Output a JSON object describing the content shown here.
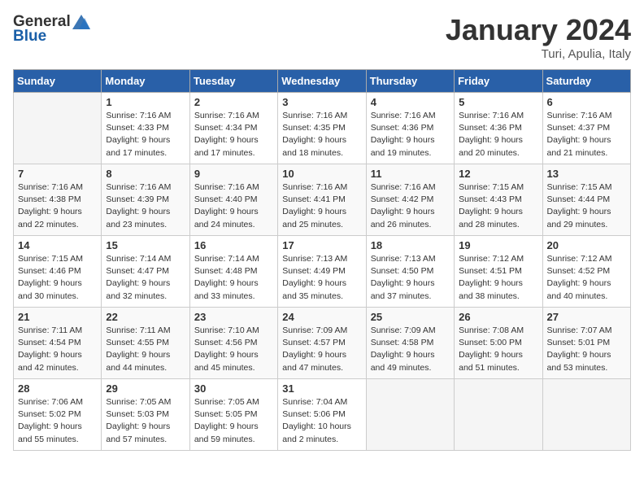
{
  "logo": {
    "general": "General",
    "blue": "Blue"
  },
  "title": {
    "month": "January 2024",
    "location": "Turi, Apulia, Italy"
  },
  "days_header": [
    "Sunday",
    "Monday",
    "Tuesday",
    "Wednesday",
    "Thursday",
    "Friday",
    "Saturday"
  ],
  "weeks": [
    [
      {
        "num": "",
        "info": ""
      },
      {
        "num": "1",
        "info": "Sunrise: 7:16 AM\nSunset: 4:33 PM\nDaylight: 9 hours\nand 17 minutes."
      },
      {
        "num": "2",
        "info": "Sunrise: 7:16 AM\nSunset: 4:34 PM\nDaylight: 9 hours\nand 17 minutes."
      },
      {
        "num": "3",
        "info": "Sunrise: 7:16 AM\nSunset: 4:35 PM\nDaylight: 9 hours\nand 18 minutes."
      },
      {
        "num": "4",
        "info": "Sunrise: 7:16 AM\nSunset: 4:36 PM\nDaylight: 9 hours\nand 19 minutes."
      },
      {
        "num": "5",
        "info": "Sunrise: 7:16 AM\nSunset: 4:36 PM\nDaylight: 9 hours\nand 20 minutes."
      },
      {
        "num": "6",
        "info": "Sunrise: 7:16 AM\nSunset: 4:37 PM\nDaylight: 9 hours\nand 21 minutes."
      }
    ],
    [
      {
        "num": "7",
        "info": "Sunrise: 7:16 AM\nSunset: 4:38 PM\nDaylight: 9 hours\nand 22 minutes."
      },
      {
        "num": "8",
        "info": "Sunrise: 7:16 AM\nSunset: 4:39 PM\nDaylight: 9 hours\nand 23 minutes."
      },
      {
        "num": "9",
        "info": "Sunrise: 7:16 AM\nSunset: 4:40 PM\nDaylight: 9 hours\nand 24 minutes."
      },
      {
        "num": "10",
        "info": "Sunrise: 7:16 AM\nSunset: 4:41 PM\nDaylight: 9 hours\nand 25 minutes."
      },
      {
        "num": "11",
        "info": "Sunrise: 7:16 AM\nSunset: 4:42 PM\nDaylight: 9 hours\nand 26 minutes."
      },
      {
        "num": "12",
        "info": "Sunrise: 7:15 AM\nSunset: 4:43 PM\nDaylight: 9 hours\nand 28 minutes."
      },
      {
        "num": "13",
        "info": "Sunrise: 7:15 AM\nSunset: 4:44 PM\nDaylight: 9 hours\nand 29 minutes."
      }
    ],
    [
      {
        "num": "14",
        "info": "Sunrise: 7:15 AM\nSunset: 4:46 PM\nDaylight: 9 hours\nand 30 minutes."
      },
      {
        "num": "15",
        "info": "Sunrise: 7:14 AM\nSunset: 4:47 PM\nDaylight: 9 hours\nand 32 minutes."
      },
      {
        "num": "16",
        "info": "Sunrise: 7:14 AM\nSunset: 4:48 PM\nDaylight: 9 hours\nand 33 minutes."
      },
      {
        "num": "17",
        "info": "Sunrise: 7:13 AM\nSunset: 4:49 PM\nDaylight: 9 hours\nand 35 minutes."
      },
      {
        "num": "18",
        "info": "Sunrise: 7:13 AM\nSunset: 4:50 PM\nDaylight: 9 hours\nand 37 minutes."
      },
      {
        "num": "19",
        "info": "Sunrise: 7:12 AM\nSunset: 4:51 PM\nDaylight: 9 hours\nand 38 minutes."
      },
      {
        "num": "20",
        "info": "Sunrise: 7:12 AM\nSunset: 4:52 PM\nDaylight: 9 hours\nand 40 minutes."
      }
    ],
    [
      {
        "num": "21",
        "info": "Sunrise: 7:11 AM\nSunset: 4:54 PM\nDaylight: 9 hours\nand 42 minutes."
      },
      {
        "num": "22",
        "info": "Sunrise: 7:11 AM\nSunset: 4:55 PM\nDaylight: 9 hours\nand 44 minutes."
      },
      {
        "num": "23",
        "info": "Sunrise: 7:10 AM\nSunset: 4:56 PM\nDaylight: 9 hours\nand 45 minutes."
      },
      {
        "num": "24",
        "info": "Sunrise: 7:09 AM\nSunset: 4:57 PM\nDaylight: 9 hours\nand 47 minutes."
      },
      {
        "num": "25",
        "info": "Sunrise: 7:09 AM\nSunset: 4:58 PM\nDaylight: 9 hours\nand 49 minutes."
      },
      {
        "num": "26",
        "info": "Sunrise: 7:08 AM\nSunset: 5:00 PM\nDaylight: 9 hours\nand 51 minutes."
      },
      {
        "num": "27",
        "info": "Sunrise: 7:07 AM\nSunset: 5:01 PM\nDaylight: 9 hours\nand 53 minutes."
      }
    ],
    [
      {
        "num": "28",
        "info": "Sunrise: 7:06 AM\nSunset: 5:02 PM\nDaylight: 9 hours\nand 55 minutes."
      },
      {
        "num": "29",
        "info": "Sunrise: 7:05 AM\nSunset: 5:03 PM\nDaylight: 9 hours\nand 57 minutes."
      },
      {
        "num": "30",
        "info": "Sunrise: 7:05 AM\nSunset: 5:05 PM\nDaylight: 9 hours\nand 59 minutes."
      },
      {
        "num": "31",
        "info": "Sunrise: 7:04 AM\nSunset: 5:06 PM\nDaylight: 10 hours\nand 2 minutes."
      },
      {
        "num": "",
        "info": ""
      },
      {
        "num": "",
        "info": ""
      },
      {
        "num": "",
        "info": ""
      }
    ]
  ]
}
